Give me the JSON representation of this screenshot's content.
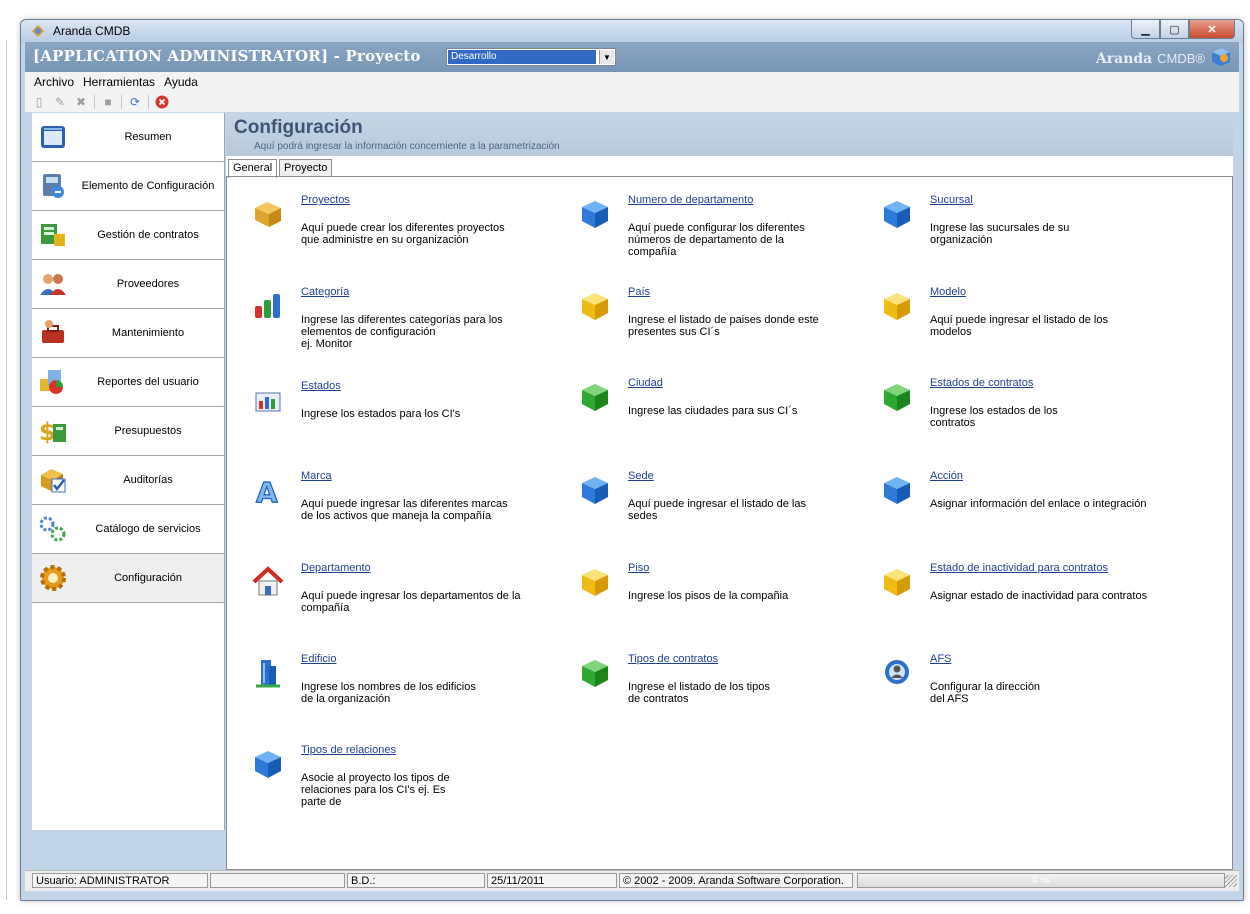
{
  "window": {
    "title": "Aranda CMDB",
    "controls": [
      "minimize",
      "maximize",
      "close"
    ]
  },
  "appbar": {
    "heading": "[APPLICATION ADMINISTRATOR] - Proyecto",
    "project_selected": "Desarrollo",
    "brand_name": "Aranda",
    "brand_product": "CMDB",
    "brand_mark": "®"
  },
  "menu": {
    "archivo": "Archivo",
    "herramientas": "Herramientas",
    "ayuda": "Ayuda"
  },
  "toolbar": {
    "icons": [
      "new-icon",
      "edit-icon",
      "delete-icon",
      "stop-icon",
      "refresh-icon",
      "exit-icon"
    ]
  },
  "sidebar": {
    "items": [
      {
        "label": "Resumen",
        "icon": "summary-icon"
      },
      {
        "label": "Elemento de Configuración",
        "icon": "config-element-icon"
      },
      {
        "label": "Gestión de contratos",
        "icon": "contracts-icon"
      },
      {
        "label": "Proveedores",
        "icon": "providers-icon"
      },
      {
        "label": "Mantenimiento",
        "icon": "maintenance-icon"
      },
      {
        "label": "Reportes del usuario",
        "icon": "reports-icon"
      },
      {
        "label": "Presupuestos",
        "icon": "budget-icon"
      },
      {
        "label": "Auditorías",
        "icon": "audit-icon"
      },
      {
        "label": "Catálogo de servicios",
        "icon": "catalog-icon"
      },
      {
        "label": "Configuración",
        "icon": "configuration-icon"
      }
    ],
    "active_index": 9
  },
  "content": {
    "title": "Configuración",
    "subtitle": "Aquí podrá ingresar la información concerniente a la parametrización",
    "tabs": [
      "General",
      "Proyecto"
    ],
    "active_tab": "General",
    "items": [
      {
        "link": "Proyectos",
        "desc": "Aquí puede crear los diferentes proyectos\nque administre en su organización",
        "icon": "folder-box-icon"
      },
      {
        "link": "Numero de departamento",
        "desc": "Aquí puede configurar los diferentes\nnúmeros de departamento de la\ncompañía",
        "icon": "blue-cube-icon"
      },
      {
        "link": "Sucursal",
        "desc": "Ingrese las sucursales de su\norganización",
        "icon": "blue-cube-icon"
      },
      {
        "link": "Categoría",
        "desc": "Ingrese las diferentes categorías para los\nelementos de configuración\nej. Monitor",
        "icon": "bar-chart-icon"
      },
      {
        "link": "País",
        "desc": "Ingrese el listado de paises donde este\npresentes sus CI´s",
        "icon": "yellow-cube-icon"
      },
      {
        "link": "Modelo",
        "desc": "Aquí puede ingresar el listado de los\nmodelos",
        "icon": "yellow-cube-icon"
      },
      {
        "link": "Estados",
        "desc": "Ingrese los estados para los CI's",
        "icon": "small-chart-icon"
      },
      {
        "link": "Ciudad",
        "desc": "Ingrese las ciudades para sus CI´s",
        "icon": "green-cube-icon"
      },
      {
        "link": "Estados de contratos",
        "desc": "Ingrese los estados de los\ncontratos",
        "icon": "green-cube-icon"
      },
      {
        "link": "Marca",
        "desc": "Aquí puede ingresar las diferentes marcas\nde los activos que maneja la compañía",
        "icon": "letter-a-icon"
      },
      {
        "link": "Sede",
        "desc": "Aquí puede ingresar el listado de las\nsedes",
        "icon": "blue-cube-icon"
      },
      {
        "link": "Acción",
        "desc": "Asignar información del enlace o integración",
        "icon": "blue-cube-icon"
      },
      {
        "link": "Departamento",
        "desc": "Aquí puede ingresar los departamentos de la\ncompañía",
        "icon": "house-icon"
      },
      {
        "link": "Piso",
        "desc": "Ingrese los pisos de la compañia",
        "icon": "yellow-cube-icon"
      },
      {
        "link": "Estado de inactividad para contratos",
        "desc": "Asignar estado de inactividad para contratos",
        "icon": "yellow-cube-icon"
      },
      {
        "link": "Edificio",
        "desc": "Ingrese los nombres de los edificios\nde la organización",
        "icon": "building-icon"
      },
      {
        "link": "Tipos de contratos",
        "desc": "Ingrese el listado de los tipos\nde contratos",
        "icon": "green-cube-icon"
      },
      {
        "link": "AFS",
        "desc": "Configurar la dirección\ndel AFS",
        "icon": "globe-user-icon"
      },
      {
        "link": "Tipos de relaciones",
        "desc": "Asocie al proyecto los tipos de\nrelaciones para los CI's ej. Es\nparte de",
        "icon": "blue-cube-icon"
      }
    ]
  },
  "statusbar": {
    "user": "Usuario: ADMINISTRATOR",
    "db": "B.D.:",
    "date": "25/11/2011",
    "copyright": "© 2002 - 2009. Aranda Software Corporation.",
    "progress_text": "0 %",
    "progress_value": 0
  },
  "colors": {
    "link": "#1e3f90",
    "appbar": "#7f9cbc",
    "header_text": "#3f5574",
    "cube_blue": "#1f74d6",
    "cube_yellow": "#f2c40f",
    "cube_green": "#22a022"
  }
}
